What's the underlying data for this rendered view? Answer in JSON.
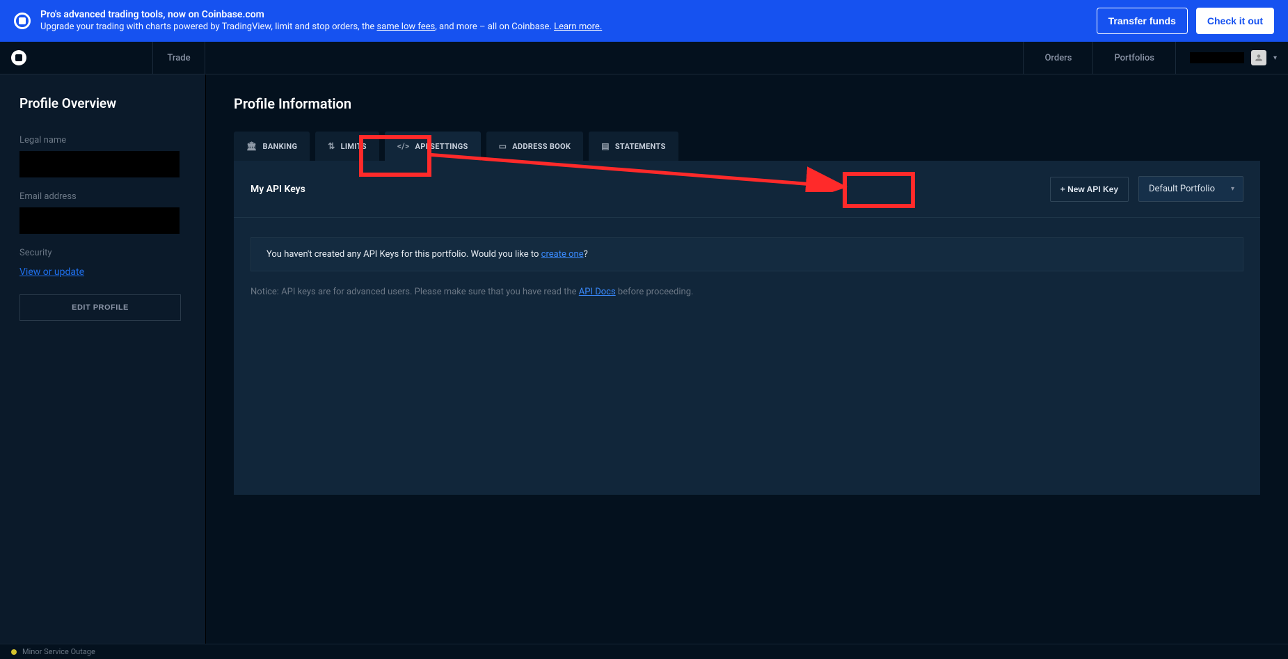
{
  "banner": {
    "title": "Pro's advanced trading tools, now on Coinbase.com",
    "subtitle_pre": "Upgrade your trading with charts powered by TradingView, limit and stop orders, the ",
    "subtitle_link1": "same low fees",
    "subtitle_mid": ", and more – all on Coinbase. ",
    "subtitle_link2": "Learn more.",
    "transfer_btn": "Transfer funds",
    "check_btn": "Check it out"
  },
  "topnav": {
    "trade": "Trade",
    "orders": "Orders",
    "portfolios": "Portfolios"
  },
  "sidebar": {
    "heading": "Profile Overview",
    "legal_label": "Legal name",
    "email_label": "Email address",
    "security_label": "Security",
    "security_link": "View or update",
    "edit_btn": "EDIT PROFILE"
  },
  "main": {
    "heading": "Profile Information",
    "tabs": {
      "banking": "BANKING",
      "limits": "LIMITS",
      "api": "API SETTINGS",
      "address": "ADDRESS BOOK",
      "statements": "STATEMENTS"
    },
    "panel": {
      "title": "My API Keys",
      "new_key": "+ New API Key",
      "portfolio": "Default Portfolio",
      "empty_pre": "You haven't created any API Keys for this portfolio. Would you like to ",
      "empty_link": "create one",
      "empty_post": "?",
      "notice_pre": "Notice: API keys are for advanced users. Please make sure that you have read the ",
      "notice_link": "API Docs",
      "notice_post": " before proceeding."
    }
  },
  "status": {
    "text": "Minor Service Outage"
  }
}
